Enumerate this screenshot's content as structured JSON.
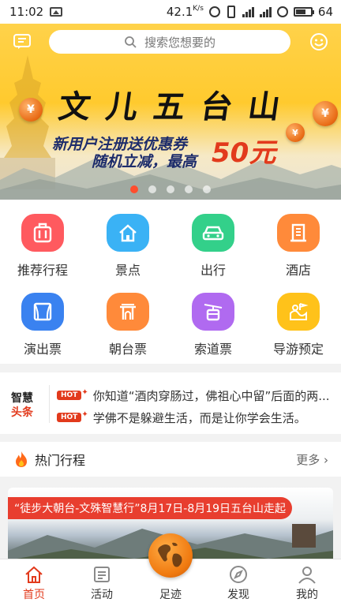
{
  "status_bar": {
    "time": "11:02",
    "speed": "42.1",
    "speed_unit": "K/s",
    "battery": "64"
  },
  "header": {
    "search_placeholder": "搜索您想要的"
  },
  "banner": {
    "title_chars": [
      "文",
      "儿",
      "五",
      "台",
      "山"
    ],
    "promo_line1": "新用户注册送优惠券",
    "promo_line2": "随机立减，最高",
    "promo_amount": "50元",
    "dot_count": 5,
    "active_dot": 0
  },
  "grid": {
    "items": [
      {
        "label": "推荐行程",
        "icon": "luggage-icon",
        "color": "#ff5a5f"
      },
      {
        "label": "景点",
        "icon": "home-icon",
        "color": "#3ab2f5"
      },
      {
        "label": "出行",
        "icon": "car-icon",
        "color": "#33d08a"
      },
      {
        "label": "酒店",
        "icon": "building-icon",
        "color": "#ff8a3a"
      },
      {
        "label": "演出票",
        "icon": "stage-icon",
        "color": "#3a82f0"
      },
      {
        "label": "朝台票",
        "icon": "gate-icon",
        "color": "#ff8a3a"
      },
      {
        "label": "索道票",
        "icon": "cable-car-icon",
        "color": "#b06af0"
      },
      {
        "label": "导游预定",
        "icon": "guide-icon",
        "color": "#ffc21a"
      }
    ]
  },
  "news": {
    "brand_line1": "智慧",
    "brand_line2": "头条",
    "badge": "HOT",
    "items": [
      "你知道“酒肉穿肠过，佛祖心中留”后面的两...",
      "学佛不是躲避生活，而是让你学会生活。"
    ]
  },
  "hot_routes": {
    "title": "热门行程",
    "more_label": "更多",
    "card_tag": "“徒步大朝台-文殊智慧行”8月17日-8月19日五台山走起"
  },
  "tabbar": {
    "tabs": [
      {
        "label": "首页",
        "icon": "home-icon",
        "active": true
      },
      {
        "label": "活动",
        "icon": "calendar-icon",
        "active": false
      },
      {
        "label": "足迹",
        "icon": "globe-icon",
        "active": false
      },
      {
        "label": "发现",
        "icon": "compass-icon",
        "active": false
      },
      {
        "label": "我的",
        "icon": "person-icon",
        "active": false
      }
    ]
  },
  "colors": {
    "accent": "#e23a1c",
    "banner_yellow": "#ffca2e"
  }
}
